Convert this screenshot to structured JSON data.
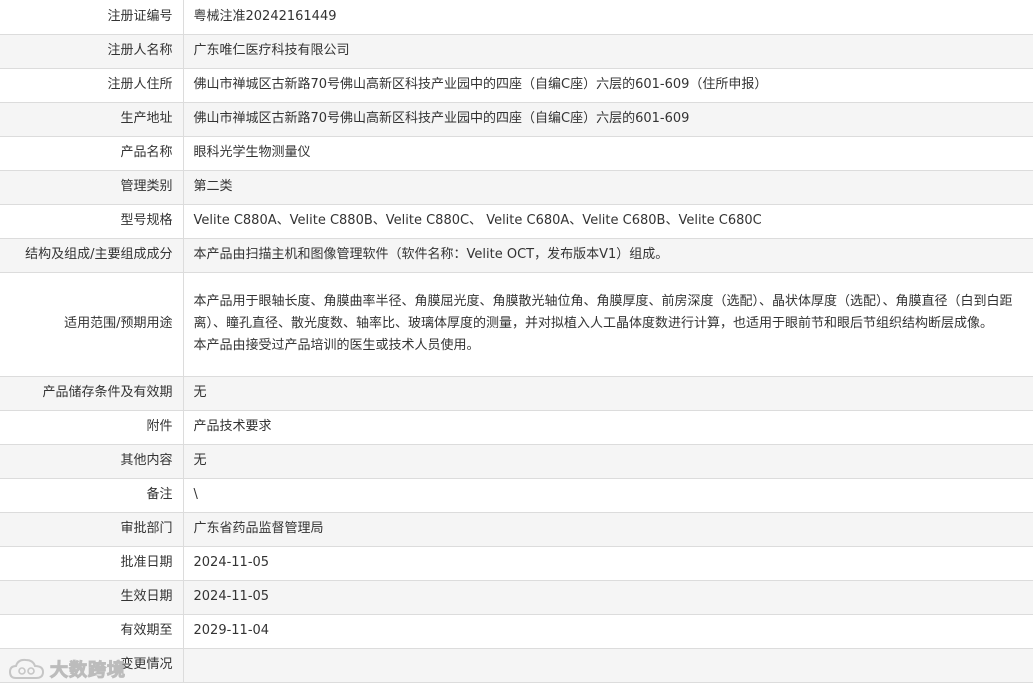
{
  "rows": [
    {
      "label": "注册证编号",
      "value": "粤械注准20242161449"
    },
    {
      "label": "注册人名称",
      "value": "广东唯仁医疗科技有限公司"
    },
    {
      "label": "注册人住所",
      "value": "佛山市禅城区古新路70号佛山高新区科技产业园中的四座（自编C座）六层的601-609（住所申报）"
    },
    {
      "label": "生产地址",
      "value": "佛山市禅城区古新路70号佛山高新区科技产业园中的四座（自编C座）六层的601-609"
    },
    {
      "label": "产品名称",
      "value": "眼科光学生物测量仪"
    },
    {
      "label": "管理类别",
      "value": "第二类"
    },
    {
      "label": "型号规格",
      "value": "Velite C880A、Velite C880B、Velite C880C、 Velite C680A、Velite C680B、Velite C680C"
    },
    {
      "label": "结构及组成/主要组成成分",
      "value": "本产品由扫描主机和图像管理软件（软件名称：Velite OCT，发布版本V1）组成。"
    },
    {
      "label": "适用范围/预期用途",
      "value_lines": [
        "本产品用于眼轴长度、角膜曲率半径、角膜屈光度、角膜散光轴位角、角膜厚度、前房深度（选配）、晶状体厚度（选配）、角膜直径（白到白距离）、瞳孔直径、散光度数、轴率比、玻璃体厚度的测量，并对拟植入人工晶体度数进行计算，也适用于眼前节和眼后节组织结构断层成像。",
        "本产品由接受过产品培训的医生或技术人员使用。"
      ]
    },
    {
      "label": "产品储存条件及有效期",
      "value": "无"
    },
    {
      "label": "附件",
      "value": "产品技术要求"
    },
    {
      "label": "其他内容",
      "value": "无"
    },
    {
      "label": "备注",
      "value": "\\"
    },
    {
      "label": "审批部门",
      "value": "广东省药品监督管理局"
    },
    {
      "label": "批准日期",
      "value": "2024-11-05"
    },
    {
      "label": "生效日期",
      "value": "2024-11-05"
    },
    {
      "label": "有效期至",
      "value": "2029-11-04"
    },
    {
      "label": "变更情况",
      "value": ""
    }
  ],
  "watermark": {
    "text": "大数跨境",
    "icon": "cloud-logo-icon"
  }
}
